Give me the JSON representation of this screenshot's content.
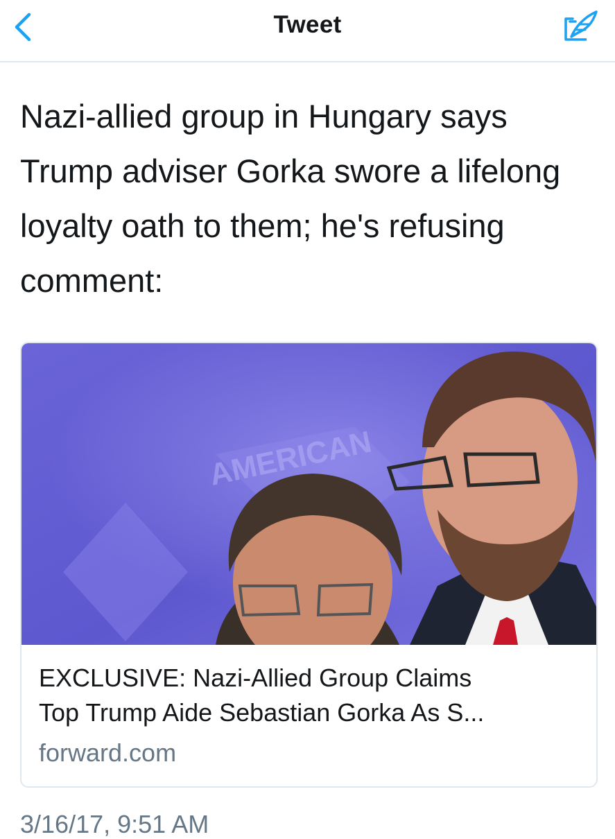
{
  "header": {
    "title": "Tweet",
    "back_icon": "chevron-left-icon",
    "compose_icon": "compose-tweet-icon",
    "accent_color": "#1da1f2"
  },
  "tweet": {
    "text": "Nazi-allied group in Hungary says Trump adviser Gorka swore a lifelong loyalty oath to them; he's refusing comment:",
    "timestamp": "3/16/17, 9:51 AM"
  },
  "card": {
    "title_line_1": "EXCLUSIVE: Nazi-Allied Group Claims",
    "title_line_2": "Top Trump Aide Sebastian Gorka As S...",
    "domain": "forward.com",
    "image_backdrop_text": "AMERICAN",
    "image_description": "photo-two-men-at-podium"
  }
}
